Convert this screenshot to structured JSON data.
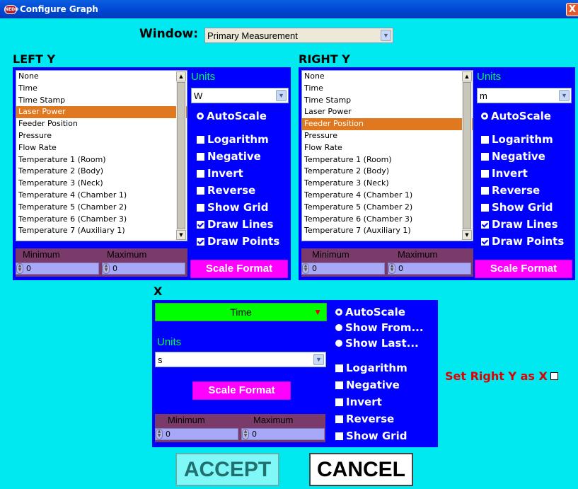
{
  "window": {
    "title": "Configure Graph",
    "icon_label": "NEDD",
    "close_label": "X"
  },
  "window_select": {
    "label": "Window:",
    "value": "Primary Measurement"
  },
  "left_y": {
    "heading": "LEFT Y",
    "list_items": [
      "None",
      "Time",
      "Time Stamp",
      "Laser Power",
      "Feeder Position",
      "Pressure",
      "Flow Rate",
      "Temperature 1 (Room)",
      "Temperature 2 (Body)",
      "Temperature 3 (Neck)",
      "Temperature 4 (Chamber 1)",
      "Temperature 5 (Chamber 2)",
      "Temperature 6 (Chamber 3)",
      "Temperature 7 (Auxiliary 1)"
    ],
    "selected_index": 3,
    "units_label": "Units",
    "units_value": "W",
    "autoscale": "AutoScale",
    "options": [
      {
        "label": "Logarithm",
        "checked": false
      },
      {
        "label": "Negative",
        "checked": false
      },
      {
        "label": "Invert",
        "checked": false
      },
      {
        "label": "Reverse",
        "checked": false
      },
      {
        "label": "Show Grid",
        "checked": false
      },
      {
        "label": "Draw Lines",
        "checked": true
      },
      {
        "label": "Draw Points",
        "checked": true
      }
    ],
    "min_label": "Minimum",
    "max_label": "Maximum",
    "min_value": "0",
    "max_value": "0",
    "scale_format": "Scale Format"
  },
  "right_y": {
    "heading": "RIGHT Y",
    "list_items": [
      "None",
      "Time",
      "Time Stamp",
      "Laser Power",
      "Feeder Position",
      "Pressure",
      "Flow Rate",
      "Temperature 1 (Room)",
      "Temperature 2 (Body)",
      "Temperature 3 (Neck)",
      "Temperature 4 (Chamber 1)",
      "Temperature 5 (Chamber 2)",
      "Temperature 6 (Chamber 3)",
      "Temperature 7 (Auxiliary 1)"
    ],
    "selected_index": 4,
    "units_label": "Units",
    "units_value": "m",
    "autoscale": "AutoScale",
    "options": [
      {
        "label": "Logarithm",
        "checked": false
      },
      {
        "label": "Negative",
        "checked": false
      },
      {
        "label": "Invert",
        "checked": false
      },
      {
        "label": "Reverse",
        "checked": false
      },
      {
        "label": "Show Grid",
        "checked": false
      },
      {
        "label": "Draw Lines",
        "checked": true
      },
      {
        "label": "Draw Points",
        "checked": true
      }
    ],
    "min_label": "Minimum",
    "max_label": "Maximum",
    "min_value": "0",
    "max_value": "0",
    "scale_format": "Scale Format"
  },
  "x_axis": {
    "heading": "X",
    "source_value": "Time",
    "units_label": "Units",
    "units_value": "s",
    "radios": [
      {
        "label": "AutoScale",
        "selected": true
      },
      {
        "label": "Show From...",
        "selected": false
      },
      {
        "label": "Show Last...",
        "selected": false
      }
    ],
    "options": [
      {
        "label": "Logarithm",
        "checked": false
      },
      {
        "label": "Negative",
        "checked": false
      },
      {
        "label": "Invert",
        "checked": false
      },
      {
        "label": "Reverse",
        "checked": false
      },
      {
        "label": "Show Grid",
        "checked": false
      }
    ],
    "scale_format": "Scale Format",
    "min_label": "Minimum",
    "max_label": "Maximum",
    "min_value": "0",
    "max_value": "0"
  },
  "set_right_y_as_x": {
    "label": "Set Right Y as X",
    "checked": false
  },
  "buttons": {
    "accept": "ACCEPT",
    "cancel": "CANCEL"
  },
  "colors": {
    "background": "#00e8f0",
    "panel": "#0000ff",
    "selected_item": "#e07820",
    "scale_format": "#ff00ff",
    "units_text": "#00ff40",
    "x_source": "#00ff00",
    "set_right_label": "#e00000"
  }
}
